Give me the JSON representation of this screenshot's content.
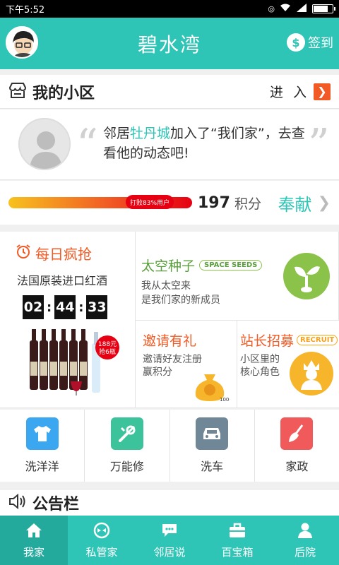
{
  "status_bar": {
    "time": "下午5:52"
  },
  "header": {
    "title": "碧水湾",
    "signin_label": "签到"
  },
  "community": {
    "title": "我的小区",
    "enter_label": "进 入"
  },
  "neighbor": {
    "prefix": "邻居",
    "name": "牡丹城",
    "suffix": "加入了“我们家”，去查看他的动态吧!"
  },
  "progress": {
    "fill_fraction": 1.0,
    "tag": "打败83%用户",
    "score": "197",
    "score_unit": "积分",
    "contribute_label": "奉献"
  },
  "daily": {
    "title": "每日疯抢",
    "subtitle": "法国原装进口红酒",
    "timer": [
      "02",
      "44",
      "33"
    ],
    "badge_line1": "188元",
    "badge_line2": "抢6瓶"
  },
  "space": {
    "title": "太空种子",
    "tag": "SPACE SEEDS",
    "desc1": "我从太空来",
    "desc2": "是我们家的新成员"
  },
  "invite": {
    "title": "邀请有礼",
    "desc1": "邀请好友注册",
    "desc2": "赢积分",
    "bag_label": "1000币"
  },
  "recruit": {
    "title": "站长招募",
    "tag": "RECRUIT",
    "desc1": "小区里的",
    "desc2": "核心角色"
  },
  "services": [
    {
      "label": "洗洋洋",
      "icon": "tshirt-icon",
      "color": "#3aa7f0"
    },
    {
      "label": "万能修",
      "icon": "tools-icon",
      "color": "#3cc39b"
    },
    {
      "label": "洗车",
      "icon": "car-icon",
      "color": "#6f8796"
    },
    {
      "label": "家政",
      "icon": "broom-icon",
      "color": "#f05a5a"
    }
  ],
  "notice": {
    "title": "公告栏"
  },
  "tabs": [
    {
      "label": "我家",
      "icon": "home-icon"
    },
    {
      "label": "私管家",
      "icon": "butler-icon"
    },
    {
      "label": "邻居说",
      "icon": "chat-icon"
    },
    {
      "label": "百宝箱",
      "icon": "toolbox-icon"
    },
    {
      "label": "后院",
      "icon": "user-icon"
    }
  ]
}
